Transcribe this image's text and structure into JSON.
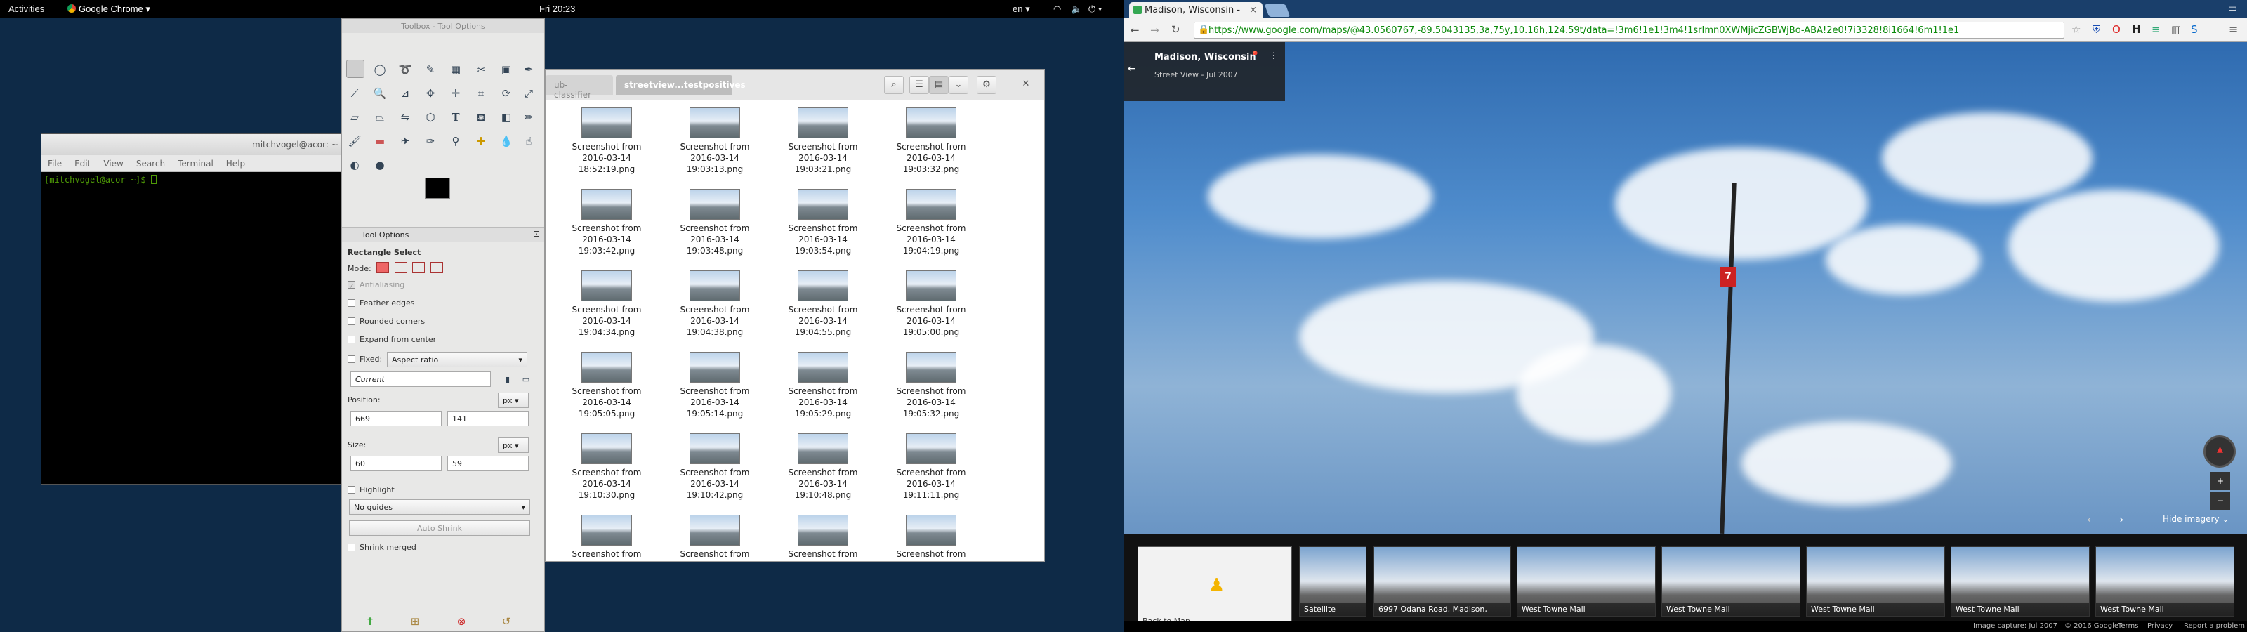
{
  "topbar": {
    "activities": "Activities",
    "app_menu": "Google Chrome ▾",
    "clock": "Fri 20:23",
    "lang": "en ▾"
  },
  "terminal": {
    "title": "mitchvogel@acor: ~",
    "menu": [
      "File",
      "Edit",
      "View",
      "Search",
      "Terminal",
      "Help"
    ],
    "prompt": "[mitchvogel@acor ~]$"
  },
  "toolbox": {
    "title": "Toolbox - Tool Options",
    "options_tab": "Tool Options",
    "tool_name": "Rectangle Select",
    "mode_label": "Mode:",
    "antialiasing": "Antialiasing",
    "feather": "Feather edges",
    "rounded": "Rounded corners",
    "expand": "Expand from center",
    "fixed_label": "Fixed:",
    "fixed_value": "Aspect ratio",
    "current": "Current",
    "position_label": "Position:",
    "position_x": "669",
    "position_y": "141",
    "size_label": "Size:",
    "size_w": "60",
    "size_h": "59",
    "unit": "px",
    "highlight": "Highlight",
    "guides": "No guides",
    "auto_shrink": "Auto Shrink",
    "shrink_merged": "Shrink merged"
  },
  "files": {
    "tab_prev": "ub-classifier",
    "tab_active": "streetview...testpositives",
    "items": [
      {
        "line1": "Screenshot from",
        "line2": "2016-03-14",
        "line3": "18:52:19.png"
      },
      {
        "line1": "Screenshot from",
        "line2": "2016-03-14",
        "line3": "19:03:13.png"
      },
      {
        "line1": "Screenshot from",
        "line2": "2016-03-14",
        "line3": "19:03:21.png"
      },
      {
        "line1": "Screenshot from",
        "line2": "2016-03-14",
        "line3": "19:03:32.png"
      },
      {
        "line1": "Screenshot from",
        "line2": "2016-03-14",
        "line3": "19:03:42.png"
      },
      {
        "line1": "Screenshot from",
        "line2": "2016-03-14",
        "line3": "19:03:48.png"
      },
      {
        "line1": "Screenshot from",
        "line2": "2016-03-14",
        "line3": "19:03:54.png"
      },
      {
        "line1": "Screenshot from",
        "line2": "2016-03-14",
        "line3": "19:04:19.png"
      },
      {
        "line1": "Screenshot from",
        "line2": "2016-03-14",
        "line3": "19:04:34.png"
      },
      {
        "line1": "Screenshot from",
        "line2": "2016-03-14",
        "line3": "19:04:38.png"
      },
      {
        "line1": "Screenshot from",
        "line2": "2016-03-14",
        "line3": "19:04:55.png"
      },
      {
        "line1": "Screenshot from",
        "line2": "2016-03-14",
        "line3": "19:05:00.png"
      },
      {
        "line1": "Screenshot from",
        "line2": "2016-03-14",
        "line3": "19:05:05.png"
      },
      {
        "line1": "Screenshot from",
        "line2": "2016-03-14",
        "line3": "19:05:14.png"
      },
      {
        "line1": "Screenshot from",
        "line2": "2016-03-14",
        "line3": "19:05:29.png"
      },
      {
        "line1": "Screenshot from",
        "line2": "2016-03-14",
        "line3": "19:05:32.png"
      },
      {
        "line1": "Screenshot from",
        "line2": "2016-03-14",
        "line3": "19:10:30.png"
      },
      {
        "line1": "Screenshot from",
        "line2": "2016-03-14",
        "line3": "19:10:42.png"
      },
      {
        "line1": "Screenshot from",
        "line2": "2016-03-14",
        "line3": "19:10:48.png"
      },
      {
        "line1": "Screenshot from",
        "line2": "2016-03-14",
        "line3": "19:11:11.png"
      },
      {
        "line1": "Screenshot from",
        "line2": "",
        "line3": ""
      },
      {
        "line1": "Screenshot from",
        "line2": "",
        "line3": ""
      },
      {
        "line1": "Screenshot from",
        "line2": "",
        "line3": ""
      },
      {
        "line1": "Screenshot from",
        "line2": "",
        "line3": ""
      }
    ]
  },
  "chrome": {
    "tab_title": "Madison, Wisconsin -",
    "url": "https://www.google.com/maps/@43.0560767,-89.5043135,3a,75y,10.16h,124.59t/data=!3m6!1e1!3m4!1srImn0XWMjicZGBWjBo-ABA!2e0!7i3328!8i1664!6m1!1e1",
    "place": "Madison, Wisconsin",
    "sv_date": "Street View - Jul 2007",
    "hide_imagery": "Hide imagery",
    "back_to_map": "Back to Map",
    "film": [
      "Satellite",
      "6997 Odana Road, Madison,",
      "West Towne Mall",
      "West Towne Mall",
      "West Towne Mall",
      "West Towne Mall",
      "West Towne Mall"
    ],
    "footer": {
      "capture": "Image capture: Jul 2007",
      "copyright": "© 2016 Google",
      "terms": "Terms",
      "privacy": "Privacy",
      "report": "Report a problem"
    }
  },
  "colors": {
    "accent": "#1a73e8",
    "toolbox_bg": "#e8e8e7",
    "topbar": "#000000"
  }
}
